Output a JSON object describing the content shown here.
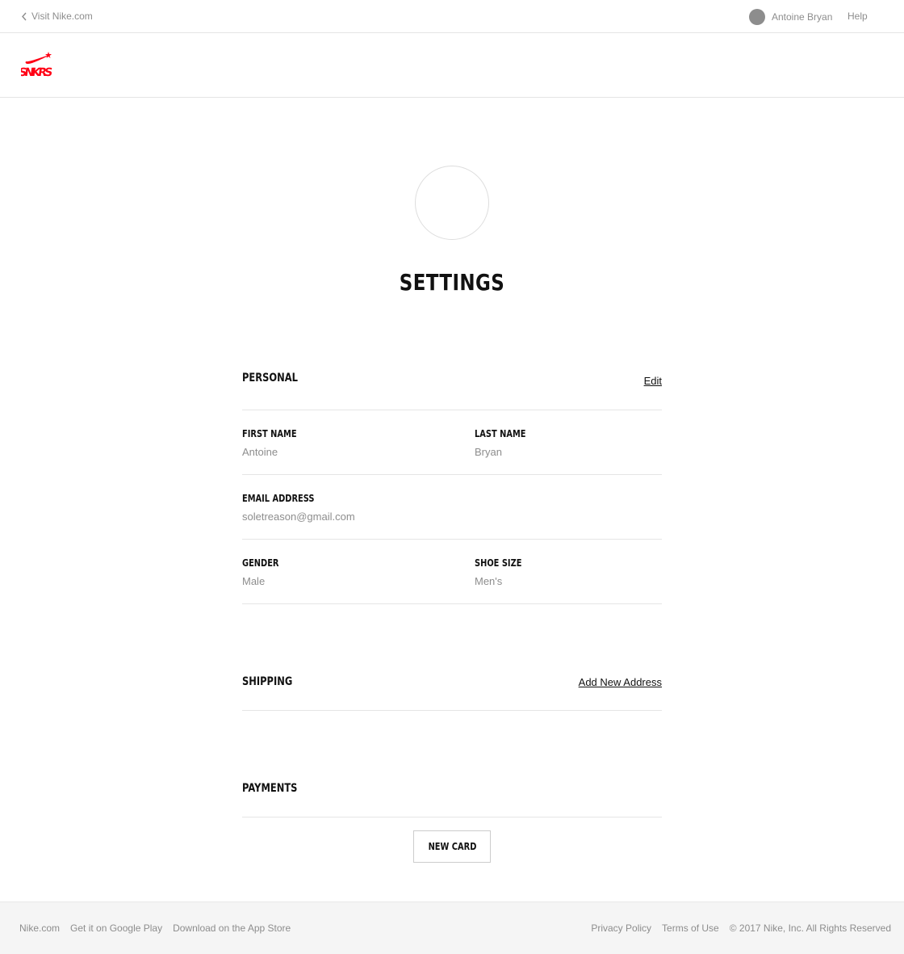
{
  "topbar": {
    "visit_label": "Visit Nike.com",
    "user_name": "Antoine Bryan",
    "help_label": "Help"
  },
  "brand": {
    "logo_text": "SNKRS",
    "logo_color": "#ff0015"
  },
  "page": {
    "title": "SETTINGS"
  },
  "personal": {
    "title": "PERSONAL",
    "edit_label": "Edit",
    "first_name_label": "FIRST NAME",
    "first_name_value": "Antoine",
    "last_name_label": "LAST NAME",
    "last_name_value": "Bryan",
    "email_label": "EMAIL ADDRESS",
    "email_value": "soletreason@gmail.com",
    "gender_label": "GENDER",
    "gender_value": "Male",
    "shoe_size_label": "SHOE SIZE",
    "shoe_size_value": "Men's"
  },
  "shipping": {
    "title": "SHIPPING",
    "add_address_label": "Add New Address"
  },
  "payments": {
    "title": "PAYMENTS",
    "new_card_label": "NEW CARD"
  },
  "footer": {
    "links_left": [
      "Nike.com",
      "Get it on Google Play",
      "Download on the App Store"
    ],
    "privacy_label": "Privacy Policy",
    "terms_label": "Terms of Use",
    "copyright": "© 2017 Nike, Inc. All Rights Reserved"
  }
}
